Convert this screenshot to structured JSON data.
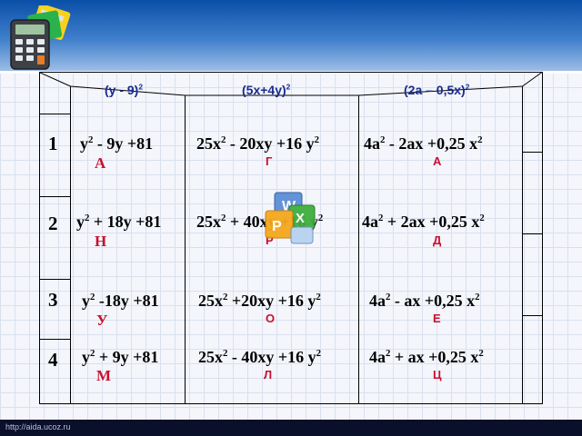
{
  "headers": [
    "(y - 9)",
    "(5x+4y)",
    "(2a – 0,5x)"
  ],
  "header_exp": "2",
  "rows": [
    {
      "num": "1",
      "c1": {
        "expr_a": "y",
        "sup_a": "2",
        "expr_b": " - 9y +81",
        "letter": "А"
      },
      "c2": {
        "expr_a": "25x",
        "sup_a": "2",
        "expr_b": "  - 20xy +16 y",
        "sup_b": "2",
        "letter": "Г"
      },
      "c3": {
        "expr_a": "4a",
        "sup_a": "2",
        "expr_b": "  - 2ax +0,25 x",
        "sup_b": "2",
        "letter": "А"
      }
    },
    {
      "num": "2",
      "c1": {
        "expr_a": "y",
        "sup_a": "2",
        "expr_b": " + 18y +81",
        "letter": "Н"
      },
      "c2": {
        "expr_a": "25x",
        "sup_a": "2",
        "expr_b": " + 40xy +16 y",
        "sup_b": "2",
        "letter": "Р"
      },
      "c3": {
        "expr_a": "4a",
        "sup_a": "2",
        "expr_b": "  + 2ax +0,25 x",
        "sup_b": "2",
        "letter": "Д"
      }
    },
    {
      "num": "3",
      "c1": {
        "expr_a": "y",
        "sup_a": "2",
        "expr_b": " -18y +81",
        "letter": "У"
      },
      "c2": {
        "expr_a": "25x",
        "sup_a": "2",
        "expr_b": " +20xy +16 y",
        "sup_b": "2",
        "letter": "О"
      },
      "c3": {
        "expr_a": "4a",
        "sup_a": "2",
        "expr_b": "  - ax +0,25 x",
        "sup_b": "2",
        "letter": "Е"
      }
    },
    {
      "num": "4",
      "c1": {
        "expr_a": "y",
        "sup_a": "2",
        "expr_b": " + 9y +81",
        "letter": "М"
      },
      "c2": {
        "expr_a": "25x",
        "sup_a": "2",
        "expr_b": " - 40xy +16 y",
        "sup_b": "2",
        "letter": "Л"
      },
      "c3": {
        "expr_a": "4a",
        "sup_a": "2",
        "expr_b": "  + ax +0,25 x",
        "sup_b": "2",
        "letter": "Ц"
      }
    }
  ],
  "footer_url": "http://aida.ucoz.ru",
  "icons": [
    "calculator-icon",
    "office-documents-icon"
  ],
  "colors": {
    "answer_letter": "#c8102e",
    "header_text": "#1a2b8f",
    "title_bar": "#0a4fa8"
  }
}
